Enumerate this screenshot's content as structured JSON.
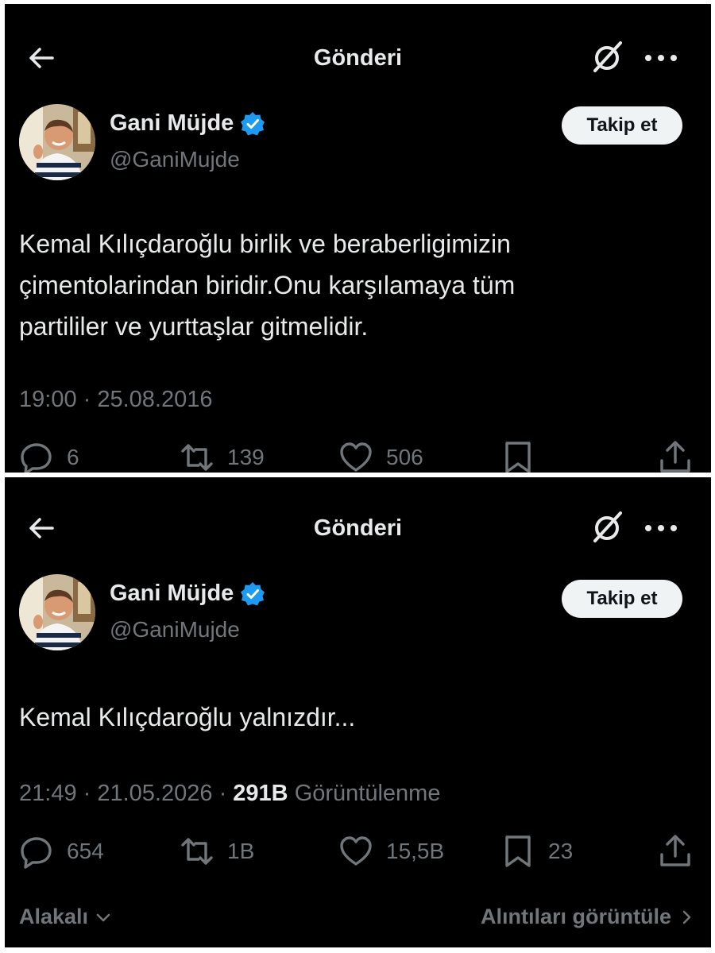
{
  "colors": {
    "background": "#000000",
    "text": "#e7e9ea",
    "secondary": "#71767b",
    "verified": "#1d9bf0",
    "follow_bg": "#eff3f4"
  },
  "panels": [
    {
      "header": {
        "title": "Gönderi"
      },
      "author": {
        "name": "Gani Müjde",
        "handle": "@GaniMujde",
        "verified": true
      },
      "follow_label": "Takip et",
      "tweet": {
        "lines": [
          "Kemal Kılıçdaroğlu birlik ve beraberligimizin",
          "çimentolarindan biridir.Onu karşılamaya tüm",
          "partililer ve yurttaşlar gitmelidir."
        ]
      },
      "meta": {
        "time": "19:00",
        "date": "25.08.2016"
      },
      "actions": {
        "replies": "6",
        "reposts": "139",
        "likes": "506"
      }
    },
    {
      "header": {
        "title": "Gönderi"
      },
      "author": {
        "name": "Gani Müjde",
        "handle": "@GaniMujde",
        "verified": true
      },
      "follow_label": "Takip et",
      "tweet": {
        "lines": [
          "Kemal Kılıçdaroğlu yalnızdır..."
        ]
      },
      "meta": {
        "time": "21:49",
        "date": "21.05.2026",
        "views": "291B",
        "views_label": "Görüntülenme"
      },
      "actions": {
        "replies": "654",
        "reposts": "1B",
        "likes": "15,5B",
        "bookmarks": "23"
      },
      "footer": {
        "left": "Alakalı",
        "right": "Alıntıları görüntüle"
      }
    }
  ]
}
